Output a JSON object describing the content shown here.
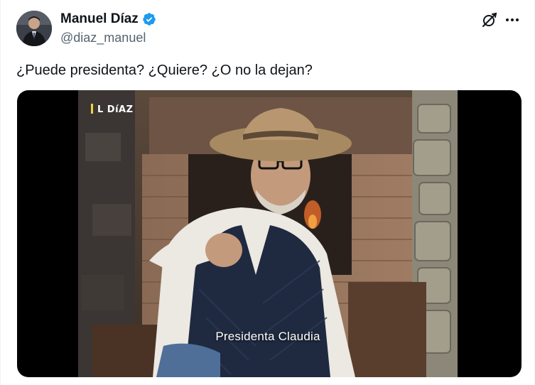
{
  "tweet": {
    "author_name": "Manuel Díaz",
    "handle": "@diaz_manuel",
    "text": "¿Puede presidenta? ¿Quiere? ¿O no la dejan?",
    "verified": true
  },
  "actions": {
    "grok_icon": "grok-icon",
    "more_icon": "more-options-icon"
  },
  "media": {
    "watermark": "L DíAZ",
    "caption": "Presidenta Claudia"
  },
  "colors": {
    "verified_blue": "#1d9bf0",
    "handle_gray": "#536471",
    "text_dark": "#0f1419"
  }
}
